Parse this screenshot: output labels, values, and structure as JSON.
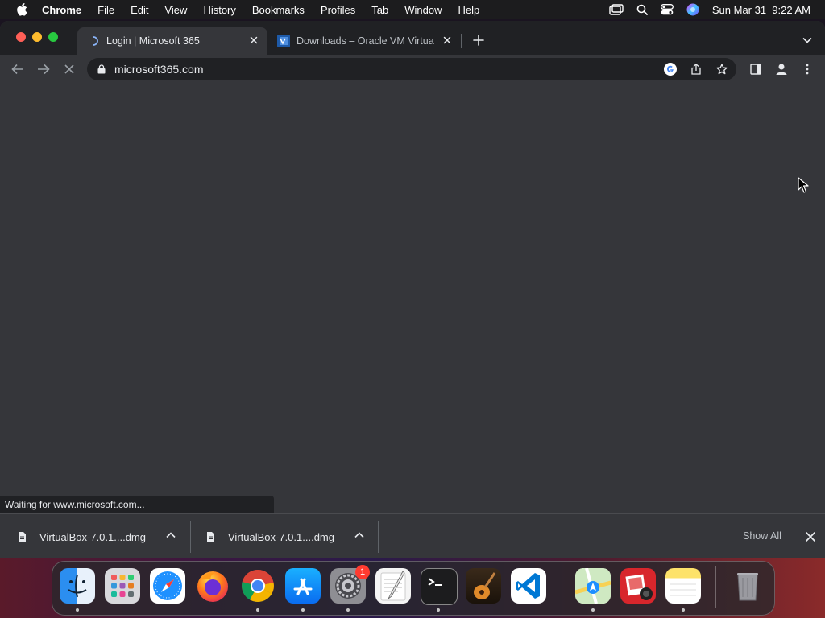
{
  "menubar": {
    "app_name": "Chrome",
    "items": [
      "File",
      "Edit",
      "View",
      "History",
      "Bookmarks",
      "Profiles",
      "Tab",
      "Window",
      "Help"
    ],
    "datetime": "Sun Mar 31  9:22 AM"
  },
  "tabs": [
    {
      "title": "Login | Microsoft 365",
      "active": true,
      "loading": true
    },
    {
      "title": "Downloads – Oracle VM Virtua",
      "active": false
    }
  ],
  "toolbar": {
    "url": "microsoft365.com"
  },
  "status": {
    "text": "Waiting for www.microsoft.com..."
  },
  "downloads": {
    "items": [
      {
        "filename": "VirtualBox-7.0.1....dmg"
      },
      {
        "filename": "VirtualBox-7.0.1....dmg"
      }
    ],
    "show_all_label": "Show All"
  },
  "dock": {
    "apps": [
      "Finder",
      "Launchpad",
      "Safari",
      "Firefox",
      "Chrome",
      "App Store",
      "System Settings",
      "TextEdit",
      "Terminal",
      "GarageBand",
      "Visual Studio Code",
      "Maps",
      "Photo Booth",
      "Notes",
      "Trash"
    ],
    "system_settings_badge": "1"
  },
  "colors": {
    "window_bg": "#35363a",
    "tabstrip_bg": "#202124",
    "accent_blue": "#8ab4f8"
  }
}
